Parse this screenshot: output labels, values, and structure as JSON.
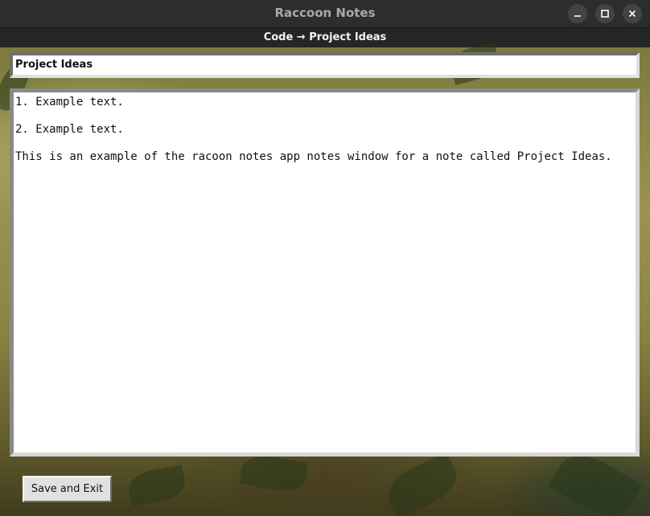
{
  "window": {
    "title": "Raccoon Notes",
    "controls": {
      "minimize_icon": "minimize-icon",
      "maximize_icon": "maximize-icon",
      "close_icon": "close-icon"
    }
  },
  "breadcrumb": {
    "text": "Code → Project Ideas"
  },
  "note": {
    "name": "Project Ideas",
    "lines": [
      "1. Example text.",
      "",
      "2. Example text.",
      "",
      "This is an example of the racoon notes app notes window for a note called Project Ideas."
    ]
  },
  "actions": {
    "save_label": "Save and Exit"
  },
  "colors": {
    "titlebar": "#2d2d2d",
    "window_control": "#434343",
    "field_background": "#ffffff",
    "button_face": "#e1e1e1"
  }
}
